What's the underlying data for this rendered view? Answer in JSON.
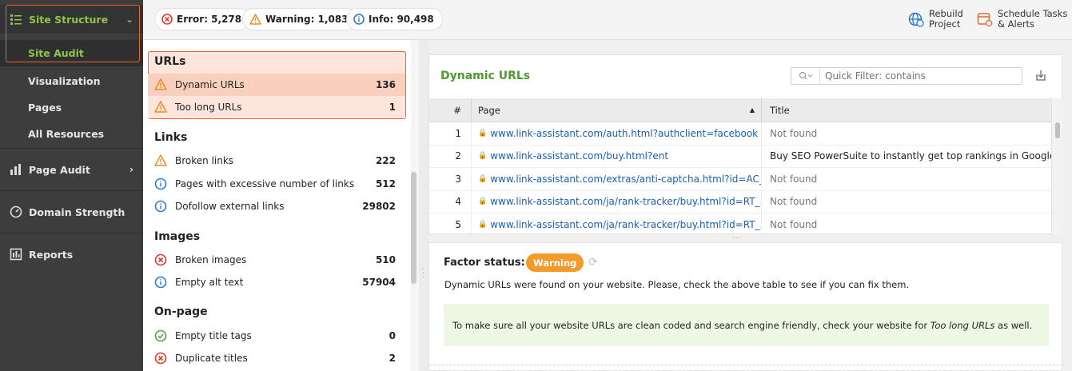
{
  "sidebar": {
    "site_structure": "Site Structure",
    "site_audit": "Site Audit",
    "visualization": "Visualization",
    "pages": "Pages",
    "all_resources": "All Resources",
    "page_audit": "Page Audit",
    "domain_strength": "Domain Strength",
    "reports": "Reports"
  },
  "topbar": {
    "error": "Error: 5,278",
    "warning": "Warning: 1,083",
    "info": "Info: 90,498",
    "rebuild_line1": "Rebuild",
    "rebuild_line2": "Project",
    "schedule_line1": "Schedule Tasks",
    "schedule_line2": "& Alerts"
  },
  "issues": {
    "urls_title": "URLs",
    "dynamic_urls": "Dynamic URLs",
    "dynamic_urls_count": "136",
    "too_long_urls": "Too long URLs",
    "too_long_urls_count": "1",
    "links_title": "Links",
    "broken_links": "Broken links",
    "broken_links_count": "222",
    "excessive_links": "Pages with excessive number of links",
    "excessive_links_count": "512",
    "dofollow": "Dofollow external links",
    "dofollow_count": "29802",
    "images_title": "Images",
    "broken_images": "Broken images",
    "broken_images_count": "510",
    "empty_alt": "Empty alt text",
    "empty_alt_count": "57904",
    "onpage_title": "On-page",
    "empty_title": "Empty title tags",
    "empty_title_count": "0",
    "duplicate_titles": "Duplicate titles",
    "duplicate_titles_count": "2"
  },
  "table": {
    "title": "Dynamic URLs",
    "filter_placeholder": "Quick Filter: contains",
    "col_num": "#",
    "col_page": "Page",
    "col_title": "Title",
    "rows": [
      {
        "num": "1",
        "page": "www.link-assistant.com/auth.html?authclient=facebook",
        "title": "Not found"
      },
      {
        "num": "2",
        "page": "www.link-assistant.com/buy.html?ent",
        "title": "Buy SEO PowerSuite to instantly get top rankings in Google"
      },
      {
        "num": "3",
        "page": "www.link-assistant.com/extras/anti-captcha.html?id=AC_...",
        "title": "Not found"
      },
      {
        "num": "4",
        "page": "www.link-assistant.com/ja/rank-tracker/buy.html?id=RT_...",
        "title": "Not found"
      },
      {
        "num": "5",
        "page": "www.link-assistant.com/ja/rank-tracker/buy.html?id=RT_...",
        "title": "Not found"
      }
    ]
  },
  "factor": {
    "label": "Factor status:",
    "badge": "Warning",
    "description": "Dynamic URLs were found on your website. Please, check the above table to see if you can fix them.",
    "note_before": "To make sure all your website URLs are clean coded and search engine friendly, check your website for ",
    "note_link": "Too long URLs",
    "note_after": " as well."
  },
  "colors": {
    "accent_orange": "#e8652b",
    "warning_badge": "#f39a2a",
    "title_green": "#4a9c2d",
    "sidebar_bg": "#3d3d3d",
    "link_blue": "#1a5fb4"
  }
}
